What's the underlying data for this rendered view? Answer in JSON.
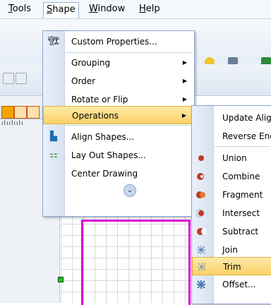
{
  "menubar": {
    "items": [
      "Tools",
      "Shape",
      "Window",
      "Help"
    ],
    "open_item": "Shape"
  },
  "shape_menu": {
    "items": [
      {
        "label": "Custom Properties...",
        "icon": "custom-properties-icon",
        "submenu": false
      },
      {
        "label": "Grouping",
        "icon": "",
        "submenu": true
      },
      {
        "label": "Order",
        "icon": "",
        "submenu": true
      },
      {
        "label": "Rotate or Flip",
        "icon": "",
        "submenu": true
      },
      {
        "label": "Operations",
        "icon": "",
        "submenu": true,
        "highlighted": true
      },
      {
        "label": "Align Shapes...",
        "icon": "align-shapes-icon",
        "submenu": false
      },
      {
        "label": "Lay Out Shapes...",
        "icon": "lay-out-shapes-icon",
        "submenu": false
      },
      {
        "label": "Center Drawing",
        "icon": "",
        "submenu": false
      }
    ],
    "expand_icon": "chevron-double-down-icon"
  },
  "operations_menu": {
    "items": [
      {
        "label": "Update Alig",
        "icon": ""
      },
      {
        "label": "Reverse End",
        "icon": ""
      },
      {
        "label": "Union",
        "icon": "union-icon"
      },
      {
        "label": "Combine",
        "icon": "combine-icon"
      },
      {
        "label": "Fragment",
        "icon": "fragment-icon"
      },
      {
        "label": "Intersect",
        "icon": "intersect-icon"
      },
      {
        "label": "Subtract",
        "icon": "subtract-icon"
      },
      {
        "label": "Join",
        "icon": "join-icon"
      },
      {
        "label": "Trim",
        "icon": "trim-icon",
        "highlighted": true
      },
      {
        "label": "Offset...",
        "icon": "offset-icon"
      }
    ]
  },
  "colors": {
    "highlight": "#fbd26a",
    "menu_border": "#8aa6cf",
    "shape_outline": "#d600d6",
    "shape_icon_red": "#c0392b"
  }
}
